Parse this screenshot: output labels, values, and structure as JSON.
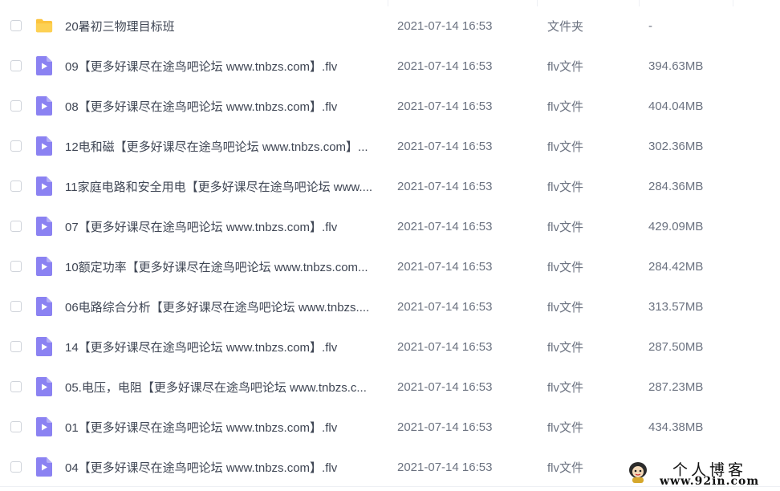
{
  "files": [
    {
      "name": "20暑初三物理目标班",
      "date": "2021-07-14 16:53",
      "type": "文件夹",
      "size": "-",
      "icon": "folder-icon"
    },
    {
      "name": "09【更多好课尽在途鸟吧论坛 www.tnbzs.com】.flv",
      "date": "2021-07-14 16:53",
      "type": "flv文件",
      "size": "394.63MB",
      "icon": "video-file-icon"
    },
    {
      "name": "08【更多好课尽在途鸟吧论坛 www.tnbzs.com】.flv",
      "date": "2021-07-14 16:53",
      "type": "flv文件",
      "size": "404.04MB",
      "icon": "video-file-icon"
    },
    {
      "name": "12电和磁【更多好课尽在途鸟吧论坛 www.tnbzs.com】...",
      "date": "2021-07-14 16:53",
      "type": "flv文件",
      "size": "302.36MB",
      "icon": "video-file-icon"
    },
    {
      "name": "11家庭电路和安全用电【更多好课尽在途鸟吧论坛 www....",
      "date": "2021-07-14 16:53",
      "type": "flv文件",
      "size": "284.36MB",
      "icon": "video-file-icon"
    },
    {
      "name": "07【更多好课尽在途鸟吧论坛 www.tnbzs.com】.flv",
      "date": "2021-07-14 16:53",
      "type": "flv文件",
      "size": "429.09MB",
      "icon": "video-file-icon"
    },
    {
      "name": "10额定功率【更多好课尽在途鸟吧论坛 www.tnbzs.com...",
      "date": "2021-07-14 16:53",
      "type": "flv文件",
      "size": "284.42MB",
      "icon": "video-file-icon"
    },
    {
      "name": "06电路综合分析【更多好课尽在途鸟吧论坛 www.tnbzs....",
      "date": "2021-07-14 16:53",
      "type": "flv文件",
      "size": "313.57MB",
      "icon": "video-file-icon"
    },
    {
      "name": "14【更多好课尽在途鸟吧论坛 www.tnbzs.com】.flv",
      "date": "2021-07-14 16:53",
      "type": "flv文件",
      "size": "287.50MB",
      "icon": "video-file-icon"
    },
    {
      "name": "05.电压，电阻【更多好课尽在途鸟吧论坛 www.tnbzs.c...",
      "date": "2021-07-14 16:53",
      "type": "flv文件",
      "size": "287.23MB",
      "icon": "video-file-icon"
    },
    {
      "name": "01【更多好课尽在途鸟吧论坛 www.tnbzs.com】.flv",
      "date": "2021-07-14 16:53",
      "type": "flv文件",
      "size": "434.38MB",
      "icon": "video-file-icon"
    },
    {
      "name": "04【更多好课尽在途鸟吧论坛 www.tnbzs.com】.flv",
      "date": "2021-07-14 16:53",
      "type": "flv文件",
      "size": "",
      "icon": "video-file-icon"
    }
  ],
  "watermark": {
    "title": "个人博客",
    "url": "www.92in.com"
  },
  "colors": {
    "folder": "#fcc43e",
    "video_icon": "#8b82f2",
    "text_primary": "#3f4654",
    "text_secondary": "#6b7280"
  }
}
